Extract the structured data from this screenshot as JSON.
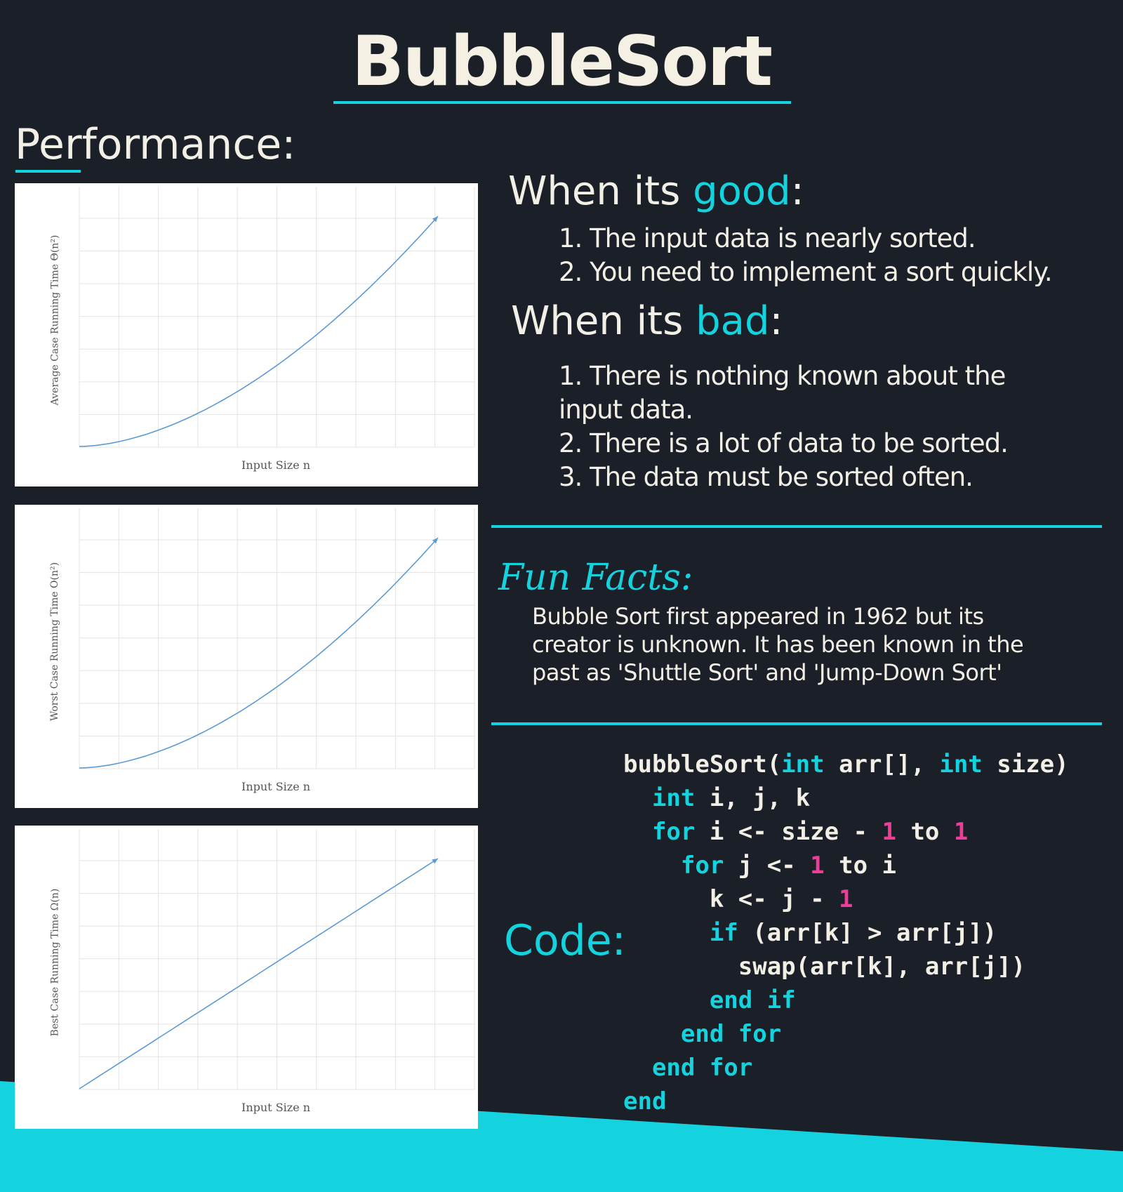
{
  "title": "BubbleSort",
  "performance": {
    "heading": "Performance:",
    "charts": [
      {
        "ylabel": "Average Case Running Time Θ(n²)",
        "xlabel": "Input Size n",
        "curve": "quadratic"
      },
      {
        "ylabel": "Worst Case Running Time O(n²)",
        "xlabel": "Input Size n",
        "curve": "quadratic"
      },
      {
        "ylabel": "Best Case Running Time Ω(n)",
        "xlabel": "Input Size n",
        "curve": "linear"
      }
    ]
  },
  "good": {
    "heading_prefix": "When its ",
    "heading_highlight": "good",
    "heading_suffix": ":",
    "items": [
      "1. The input data is nearly sorted.",
      "2. You need to implement a sort quickly."
    ]
  },
  "bad": {
    "heading_prefix": "When its ",
    "heading_highlight": "bad",
    "heading_suffix": ":",
    "items": [
      "1. There is nothing known about the",
      "input data.",
      "2. There is a lot of data to be sorted.",
      "3. The data must be sorted often."
    ]
  },
  "fun_facts": {
    "heading": "Fun Facts:",
    "lines": [
      "Bubble Sort first appeared in 1962 but its",
      "creator is unknown. It has been known in the",
      "past as 'Shuttle Sort' and 'Jump-Down Sort'"
    ]
  },
  "code": {
    "label": "Code:",
    "lines": [
      [
        {
          "t": "bubbleSort("
        },
        {
          "t": "int",
          "k": "kw"
        },
        {
          "t": " arr[], "
        },
        {
          "t": "int",
          "k": "kw"
        },
        {
          "t": " size)"
        }
      ],
      [
        {
          "t": "  "
        },
        {
          "t": "int",
          "k": "kw"
        },
        {
          "t": " i, j, k"
        }
      ],
      [
        {
          "t": "  "
        },
        {
          "t": "for",
          "k": "kw"
        },
        {
          "t": " i <- size - "
        },
        {
          "t": "1",
          "k": "num"
        },
        {
          "t": " to "
        },
        {
          "t": "1",
          "k": "num"
        }
      ],
      [
        {
          "t": "    "
        },
        {
          "t": "for",
          "k": "kw"
        },
        {
          "t": " j <- "
        },
        {
          "t": "1",
          "k": "num"
        },
        {
          "t": " to i"
        }
      ],
      [
        {
          "t": "      k <- j - "
        },
        {
          "t": "1",
          "k": "num"
        }
      ],
      [
        {
          "t": "      "
        },
        {
          "t": "if",
          "k": "kw"
        },
        {
          "t": " (arr[k] > arr[j])"
        }
      ],
      [
        {
          "t": "        swap(arr[k], arr[j])"
        }
      ],
      [
        {
          "t": "      "
        },
        {
          "t": "end if",
          "k": "kw"
        }
      ],
      [
        {
          "t": "    "
        },
        {
          "t": "end for",
          "k": "kw"
        }
      ],
      [
        {
          "t": "  "
        },
        {
          "t": "end for",
          "k": "kw"
        }
      ],
      [
        {
          "t": "end",
          "k": "kw"
        }
      ]
    ]
  },
  "colors": {
    "background": "#1b1f27",
    "accent": "#14d3de",
    "text": "#f2efe6",
    "number": "#ec3d98",
    "chart_line": "#5b9bd5"
  }
}
